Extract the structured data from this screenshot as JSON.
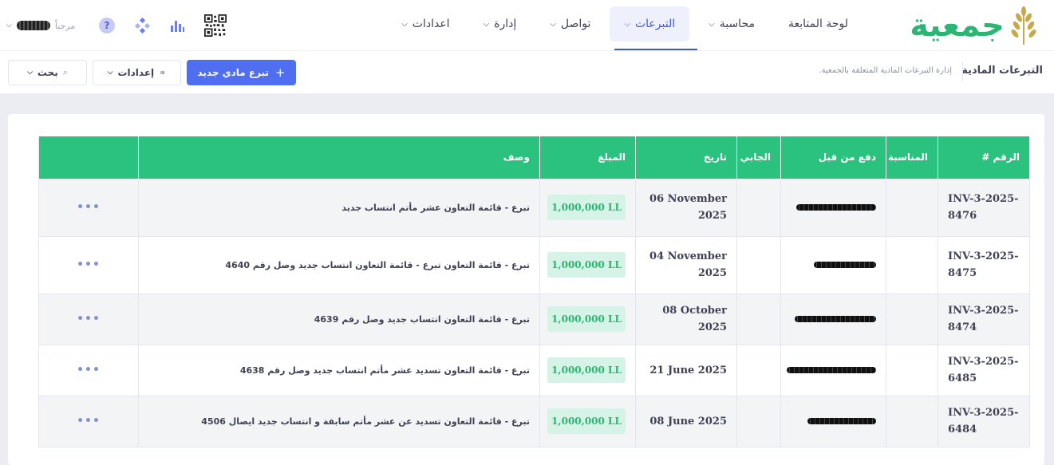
{
  "brand": {
    "logo_text": "جمعية"
  },
  "nav": {
    "items": [
      {
        "label": "لوحة المتابعة",
        "has_menu": false
      },
      {
        "label": "محاسبة",
        "has_menu": true
      },
      {
        "label": "التبرعات",
        "has_menu": true,
        "active": true
      },
      {
        "label": "تواصل",
        "has_menu": true
      },
      {
        "label": "إدارة",
        "has_menu": true
      },
      {
        "label": "اعدادات",
        "has_menu": true
      }
    ]
  },
  "user": {
    "greeting": "مرحباً"
  },
  "icons": {
    "help": "?"
  },
  "subheader": {
    "title": "التبرعات المادية",
    "description": "إدارة التبرعات المادية المتعلقة بالجمعية.",
    "new_button": "تبرع مادي جديد",
    "settings_button": "إعدادات",
    "search_button": "بحث"
  },
  "table": {
    "columns": [
      "الرقم #",
      "المناسبة",
      "دفع من قبل",
      "الجابي",
      "تاريخ",
      "المبلغ",
      "وصف",
      ""
    ],
    "rows": [
      {
        "number": "INV-3-2025-8476",
        "date": "06 November 2025",
        "amount": "1,000,000 LL",
        "description": "تبرع - قائمة التعاون عشر مأتم انتساب جديد"
      },
      {
        "number": "INV-3-2025-8475",
        "date": "04 November 2025",
        "amount": "1,000,000 LL",
        "description": "تبرع - قائمة التعاون تبرع - قائمة التعاون انتساب جديد وصل رقم 4640"
      },
      {
        "number": "INV-3-2025-8474",
        "date": "08 October 2025",
        "amount": "1,000,000 LL",
        "description": "تبرع - قائمة التعاون انتساب جديد وصل رقم 4639"
      },
      {
        "number": "INV-3-2025-6485",
        "date": "21 June 2025",
        "amount": "1,000,000 LL",
        "description": "تبرع - قائمة التعاون تسديد عشر مأتم انتساب جديد وصل رقم 4638"
      },
      {
        "number": "INV-3-2025-6484",
        "date": "08 June 2025",
        "amount": "1,000,000 LL",
        "description": "تبرع - قائمة التعاون تسديد عن عشر مأتم سابقة و انتساب جديد ايصال 4506"
      }
    ],
    "row_actions": "•••"
  },
  "colors": {
    "accent": "#4f6ef0",
    "header_green": "#2bc17e",
    "logo_green": "#2bb673"
  }
}
